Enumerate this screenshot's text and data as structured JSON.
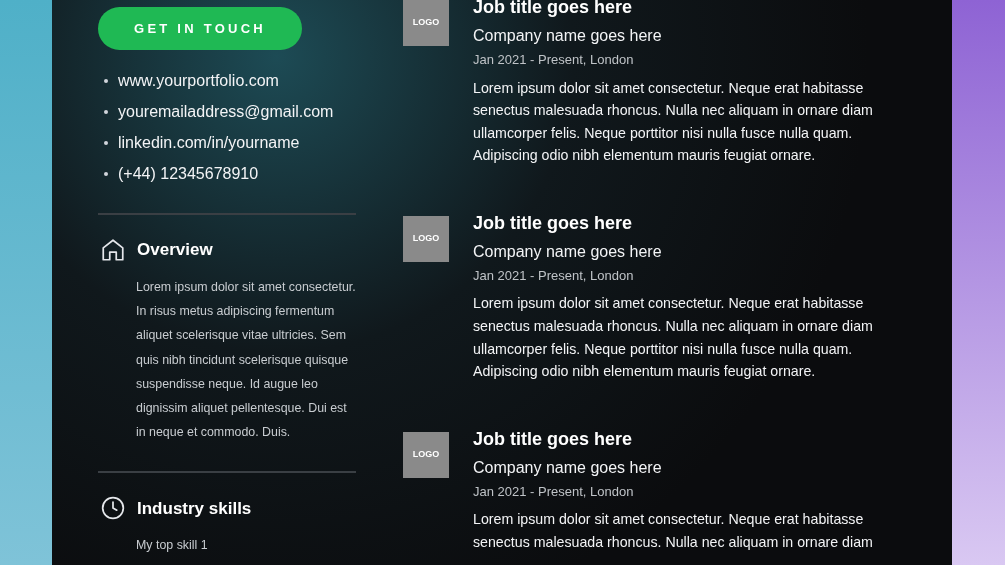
{
  "contact": {
    "button": "GET IN TOUCH",
    "links": [
      "www.yourportfolio.com",
      "youremailaddress@gmail.com",
      "linkedin.com/in/yourname",
      "(+44) 12345678910"
    ]
  },
  "sections": [
    {
      "kind": "home",
      "title": "Overview",
      "body": "Lorem ipsum dolor sit amet consectetur. In risus metus adipiscing fermentum aliquet scelerisque vitae ultricies. Sem quis nibh tincidunt scelerisque quisque suspendisse neque. Id augue leo dignissim aliquet pellentesque. Dui est in neque et commodo. Duis."
    },
    {
      "kind": "clock",
      "title": "Industry skills",
      "body": "My top skill 1"
    }
  ],
  "jobs": [
    {
      "logo": "LOGO",
      "title": "Job title goes here",
      "company": "Company name goes here",
      "dates": "Jan 2021 - Present, London",
      "description": "Lorem ipsum dolor sit amet consectetur. Neque erat habitasse senectus malesuada rhoncus. Nulla nec aliquam in ornare diam ullamcorper felis. Neque porttitor nisi nulla fusce nulla quam. Adipiscing odio nibh elementum mauris feugiat ornare."
    },
    {
      "logo": "LOGO",
      "title": "Job title goes here",
      "company": "Company name goes here",
      "dates": "Jan 2021 - Present, London",
      "description": "Lorem ipsum dolor sit amet consectetur. Neque erat habitasse senectus malesuada rhoncus. Nulla nec aliquam in ornare diam ullamcorper felis. Neque porttitor nisi nulla fusce nulla quam. Adipiscing odio nibh elementum mauris feugiat ornare."
    },
    {
      "logo": "LOGO",
      "title": "Job title goes here",
      "company": "Company name goes here",
      "dates": "Jan 2021 - Present, London",
      "description": "Lorem ipsum dolor sit amet consectetur. Neque erat habitasse senectus malesuada rhoncus. Nulla nec aliquam in ornare diam"
    }
  ]
}
